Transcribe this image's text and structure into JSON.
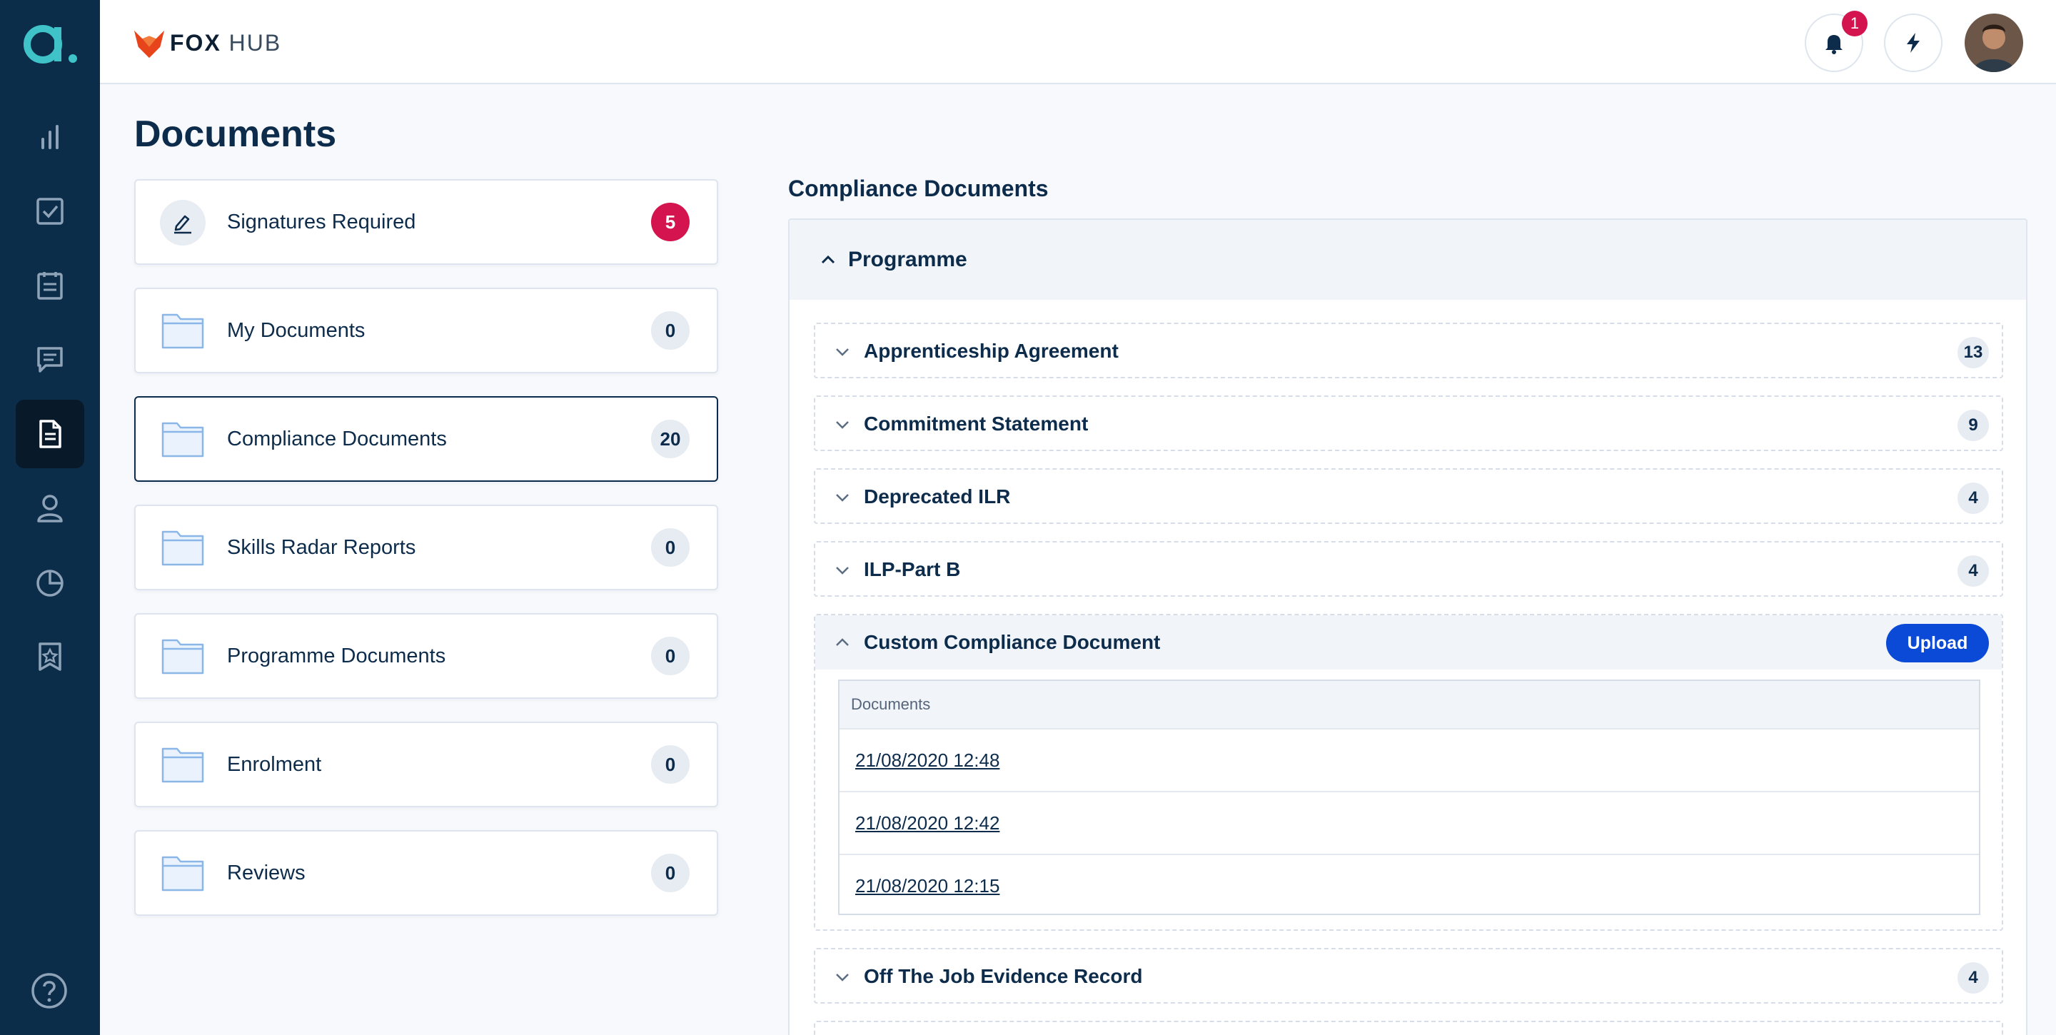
{
  "brand": {
    "name_bold": "FOX",
    "name_light": "HUB"
  },
  "rail": {
    "items": [
      {
        "name": "nav-analytics",
        "icon": "bar-chart-icon"
      },
      {
        "name": "nav-tasks",
        "icon": "checkbox-icon"
      },
      {
        "name": "nav-clipboard",
        "icon": "clipboard-icon"
      },
      {
        "name": "nav-messages",
        "icon": "chat-icon"
      },
      {
        "name": "nav-documents",
        "icon": "document-icon",
        "active": true
      },
      {
        "name": "nav-profile",
        "icon": "user-icon"
      },
      {
        "name": "nav-reports",
        "icon": "pie-chart-icon"
      },
      {
        "name": "nav-achievements",
        "icon": "badge-star-icon"
      }
    ],
    "help_icon": "help-icon"
  },
  "topbar": {
    "notification_count": "1"
  },
  "page": {
    "title": "Documents"
  },
  "folders": [
    {
      "label": "Signatures Required",
      "count": "5",
      "alert": true
    },
    {
      "label": "My Documents",
      "count": "0"
    },
    {
      "label": "Compliance Documents",
      "count": "20",
      "selected": true
    },
    {
      "label": "Skills Radar Reports",
      "count": "0"
    },
    {
      "label": "Programme Documents",
      "count": "0"
    },
    {
      "label": "Enrolment",
      "count": "0"
    },
    {
      "label": "Reviews",
      "count": "0"
    }
  ],
  "compliance": {
    "title": "Compliance Documents",
    "group": "Programme",
    "rows": [
      {
        "label": "Apprenticeship Agreement",
        "count": "13"
      },
      {
        "label": "Commitment Statement",
        "count": "9"
      },
      {
        "label": "Deprecated ILR",
        "count": "4"
      },
      {
        "label": "ILP-Part B",
        "count": "4"
      }
    ],
    "expanded": {
      "label": "Custom Compliance Document",
      "upload_label": "Upload",
      "table_header": "Documents",
      "documents": [
        "21/08/2020 12:48",
        "21/08/2020 12:42",
        "21/08/2020 12:15"
      ]
    },
    "after_rows": [
      {
        "label": "Off The Job Evidence Record",
        "count": "4"
      }
    ]
  },
  "colors": {
    "rail": "#0b2d4a",
    "accent": "#0a4ad6",
    "alert": "#d3144e",
    "text": "#0d2c4b"
  }
}
